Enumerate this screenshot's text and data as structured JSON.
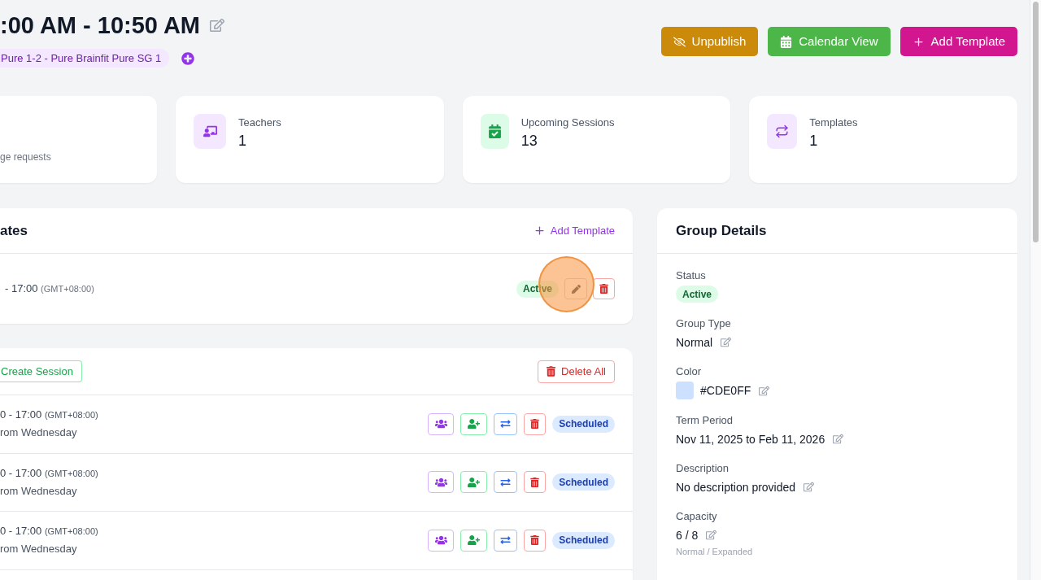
{
  "header": {
    "title": ":00 AM - 10:50 AM",
    "tag": "Pure 1-2 - Pure Brainfit Pure SG 1",
    "actions": [
      {
        "kind": "unpublish",
        "label": "Unpublish"
      },
      {
        "kind": "calendar",
        "label": "Calendar View"
      },
      {
        "kind": "add",
        "label": "Add Template"
      }
    ]
  },
  "stats": [
    {
      "kind": "partial",
      "caption": "ge requests"
    },
    {
      "kind": "teachers",
      "label": "Teachers",
      "value": "1"
    },
    {
      "kind": "sessions",
      "label": "Upcoming Sessions",
      "value": "13"
    },
    {
      "kind": "templates",
      "label": "Templates",
      "value": "1"
    }
  ],
  "templates": {
    "title": "ates",
    "add_label": "Add Template",
    "rows": [
      {
        "time": "- 17:00",
        "timezone": "(GMT+08:00)",
        "status": {
          "kind": "success",
          "label": "Active"
        },
        "cursor_highlight": true
      }
    ]
  },
  "sessions": {
    "create_label": "Create Session",
    "delete_all_label": "Delete All",
    "rows": [
      {
        "time": "0 - 17:00",
        "timezone": "(GMT+08:00)",
        "note": "rom Wednesday",
        "status": {
          "kind": "info",
          "label": "Scheduled"
        }
      },
      {
        "time": "0 - 17:00",
        "timezone": "(GMT+08:00)",
        "note": "rom Wednesday",
        "status": {
          "kind": "info",
          "label": "Scheduled"
        }
      },
      {
        "time": "0 - 17:00",
        "timezone": "(GMT+08:00)",
        "note": "rom Wednesday",
        "status": {
          "kind": "info",
          "label": "Scheduled"
        }
      }
    ]
  },
  "group_details": {
    "title": "Group Details",
    "fields": [
      {
        "kind": "badge",
        "label": "Status",
        "status": {
          "kind": "success",
          "label": "Active"
        },
        "editable": false
      },
      {
        "kind": "text",
        "label": "Group Type",
        "value": "Normal",
        "editable": true
      },
      {
        "kind": "color",
        "label": "Color",
        "value": "#CDE0FF",
        "color": "#cde0ff",
        "editable": true
      },
      {
        "kind": "text",
        "label": "Term Period",
        "value": "Nov 11, 2025 to Feb 11, 2026",
        "editable": true
      },
      {
        "kind": "text",
        "label": "Description",
        "value": "No description provided",
        "editable": true
      },
      {
        "kind": "text",
        "label": "Capacity",
        "value": "6 / 8",
        "note": "Normal / Expanded",
        "editable": true
      }
    ]
  }
}
